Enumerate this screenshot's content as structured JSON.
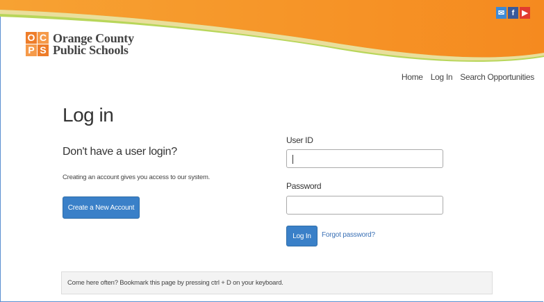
{
  "header": {
    "logo_letters": [
      "OC",
      "PS"
    ],
    "logo_line1": "Orange County",
    "logo_line2": "Public Schools",
    "social_icons": [
      "email-icon",
      "facebook-icon",
      "youtube-icon"
    ],
    "nav": [
      {
        "label": "Home"
      },
      {
        "label": "Log In"
      },
      {
        "label": "Search Opportunities"
      }
    ]
  },
  "main": {
    "title": "Log in",
    "signup": {
      "heading": "Don't have a user login?",
      "description": "Creating an account gives you access to our system.",
      "button_label": "Create a New Account"
    },
    "form": {
      "userid_label": "User ID",
      "userid_value": "",
      "password_label": "Password",
      "password_value": "",
      "login_label": "Log In",
      "forgot_label": "Forgot password?"
    },
    "tip": "Come here often? Bookmark this page by pressing ctrl + D on your keyboard."
  },
  "colors": {
    "orange": "#f7931e",
    "green": "#a6cf3a",
    "button_blue": "#3a80c8",
    "link_blue": "#3a70b5"
  }
}
